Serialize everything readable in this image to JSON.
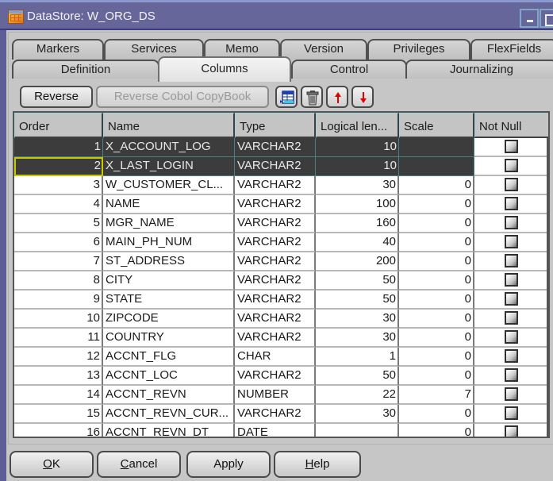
{
  "window": {
    "title": "DataStore: W_ORG_DS",
    "icon": "datastore-table-icon",
    "controls": [
      "minimize-icon",
      "maximize-icon"
    ]
  },
  "tabs": {
    "row1": [
      "Markers",
      "Services",
      "Memo",
      "Version",
      "Privileges",
      "FlexFields"
    ],
    "row2": [
      "Definition",
      "Columns",
      "Control",
      "Journalizing"
    ],
    "active": "Columns"
  },
  "toolbar": {
    "reverse_label": "Reverse",
    "reverse_cobol_label": "Reverse Cobol CopyBook",
    "icons": [
      "add-column-icon",
      "delete-trash-icon",
      "move-up-arrow-icon",
      "move-down-arrow-icon"
    ]
  },
  "grid": {
    "columns": [
      "Order",
      "Name",
      "Type",
      "Logical len...",
      "Scale",
      "Not Null"
    ],
    "rows": [
      {
        "order": "1",
        "name": "X_ACCOUNT_LOG",
        "type": "VARCHAR2",
        "length": "10",
        "scale": "",
        "not_null": false,
        "selected": true
      },
      {
        "order": "2",
        "name": "X_LAST_LOGIN",
        "type": "VARCHAR2",
        "length": "10",
        "scale": "",
        "not_null": false,
        "selected": true,
        "focused": true
      },
      {
        "order": "3",
        "name": "W_CUSTOMER_CL...",
        "type": "VARCHAR2",
        "length": "30",
        "scale": "0",
        "not_null": false
      },
      {
        "order": "4",
        "name": "NAME",
        "type": "VARCHAR2",
        "length": "100",
        "scale": "0",
        "not_null": false
      },
      {
        "order": "5",
        "name": "MGR_NAME",
        "type": "VARCHAR2",
        "length": "160",
        "scale": "0",
        "not_null": false
      },
      {
        "order": "6",
        "name": "MAIN_PH_NUM",
        "type": "VARCHAR2",
        "length": "40",
        "scale": "0",
        "not_null": false
      },
      {
        "order": "7",
        "name": "ST_ADDRESS",
        "type": "VARCHAR2",
        "length": "200",
        "scale": "0",
        "not_null": false
      },
      {
        "order": "8",
        "name": "CITY",
        "type": "VARCHAR2",
        "length": "50",
        "scale": "0",
        "not_null": false
      },
      {
        "order": "9",
        "name": "STATE",
        "type": "VARCHAR2",
        "length": "50",
        "scale": "0",
        "not_null": false
      },
      {
        "order": "10",
        "name": "ZIPCODE",
        "type": "VARCHAR2",
        "length": "30",
        "scale": "0",
        "not_null": false
      },
      {
        "order": "11",
        "name": "COUNTRY",
        "type": "VARCHAR2",
        "length": "30",
        "scale": "0",
        "not_null": false
      },
      {
        "order": "12",
        "name": "ACCNT_FLG",
        "type": "CHAR",
        "length": "1",
        "scale": "0",
        "not_null": false
      },
      {
        "order": "13",
        "name": "ACCNT_LOC",
        "type": "VARCHAR2",
        "length": "50",
        "scale": "0",
        "not_null": false
      },
      {
        "order": "14",
        "name": "ACCNT_REVN",
        "type": "NUMBER",
        "length": "22",
        "scale": "7",
        "not_null": false
      },
      {
        "order": "15",
        "name": "ACCNT_REVN_CUR...",
        "type": "VARCHAR2",
        "length": "30",
        "scale": "0",
        "not_null": false
      },
      {
        "order": "16",
        "name": "ACCNT_REVN_DT",
        "type": "DATE",
        "length": "",
        "scale": "0",
        "not_null": false
      }
    ]
  },
  "footer": {
    "ok_label": "OK",
    "ok_mnemonic": "O",
    "cancel_label": "Cancel",
    "cancel_mnemonic": "C",
    "apply_label": "Apply",
    "help_label": "Help",
    "help_mnemonic": "H"
  }
}
